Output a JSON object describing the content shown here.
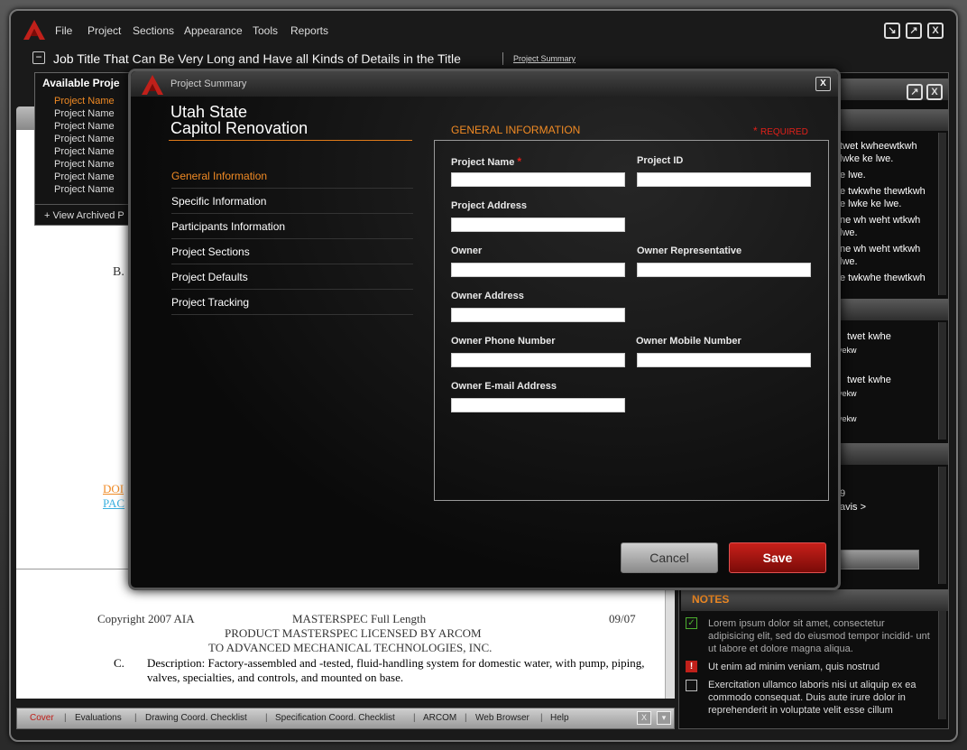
{
  "menu": {
    "items": [
      "File",
      "Project",
      "Sections",
      "Appearance",
      "Tools",
      "Reports"
    ]
  },
  "header": {
    "job_title": "Job Title That Can Be Very Long and Have all Kinds of Details in the Title",
    "project_summary_link": "Project Summary"
  },
  "available_projects": {
    "title": "Available Proje",
    "items": [
      "Project Name",
      "Project Name",
      "Project Name",
      "Project Name",
      "Project Name",
      "Project Name",
      "Project Name",
      "Project Name"
    ],
    "view_archived": "+ View Archived P"
  },
  "document": {
    "letter_b": "B.",
    "link1": "DOI",
    "link2": "PAC",
    "footer": {
      "copyright": "Copyright 2007 AIA",
      "product": "MASTERSPEC Full Length",
      "date": "09/07",
      "line2": "PRODUCT MASTERSPEC LICENSED BY ARCOM",
      "line3": "TO ADVANCED MECHANICAL TECHNOLOGIES, INC.",
      "item_letter": "C.",
      "description": "Description:  Factory-assembled and -tested, fluid-handling system for domestic water, with pump, piping, valves, specialties, and controls, and mounted on base."
    }
  },
  "bottom_tabs": [
    "Cover",
    "Evaluations",
    "Drawing Coord. Checklist",
    "Specification Coord. Checklist",
    "ARCOM",
    "Web Browser",
    "Help"
  ],
  "right_panel": {
    "block1": [
      "twet kwheewtkwh",
      "lwke ke lwe.",
      "e lwe.",
      "e twkwhe thewtkwh",
      "e lwke ke lwe.",
      "ne wh weht wtkwh",
      "lwe.",
      "ne wh weht wtkwh",
      "lwe.",
      "e twkwhe thewtkwh"
    ],
    "block2": [
      "twet kwhe",
      "vekw",
      "twet kwhe",
      "vekw",
      "vekw"
    ],
    "block3": [
      "9",
      "avis >"
    ],
    "notes_title": "NOTES",
    "notes": [
      {
        "text": "Lorem ipsum dolor sit amet, consectetur adipisicing elit, sed do eiusmod tempor incidid- unt ut labore et dolore magna aliqua.",
        "state": "checked"
      },
      {
        "text": "Ut enim ad minim veniam, quis nostrud",
        "state": "alert"
      },
      {
        "text": "Exercitation ullamco laboris nisi ut aliquip ex ea commodo consequat. Duis aute irure dolor in reprehenderit in voluptate velit esse cillum",
        "state": "empty"
      }
    ]
  },
  "modal": {
    "title": "Project Summary",
    "project_title_line1": "Utah State",
    "project_title_line2": "Capitol Renovation",
    "nav": [
      "General Information",
      "Specific Information",
      "Participants Information",
      "Project Sections",
      "Project Defaults",
      "Project Tracking"
    ],
    "section_heading": "GENERAL INFORMATION",
    "required_note": "REQUIRED",
    "fields": {
      "project_name": {
        "label": "Project Name",
        "value": ""
      },
      "project_id": {
        "label": "Project ID",
        "value": ""
      },
      "project_address": {
        "label": "Project Address",
        "value": ""
      },
      "owner": {
        "label": "Owner",
        "value": ""
      },
      "owner_rep": {
        "label": "Owner Representative",
        "value": ""
      },
      "owner_address": {
        "label": "Owner Address",
        "value": ""
      },
      "owner_phone": {
        "label": "Owner Phone Number",
        "value": ""
      },
      "owner_mobile": {
        "label": "Owner Mobile Number",
        "value": ""
      },
      "owner_email": {
        "label": "Owner E-mail Address",
        "value": ""
      }
    },
    "cancel_label": "Cancel",
    "save_label": "Save",
    "close_label": "X"
  },
  "colors": {
    "accent": "#f08a24",
    "danger": "#c8201a"
  }
}
